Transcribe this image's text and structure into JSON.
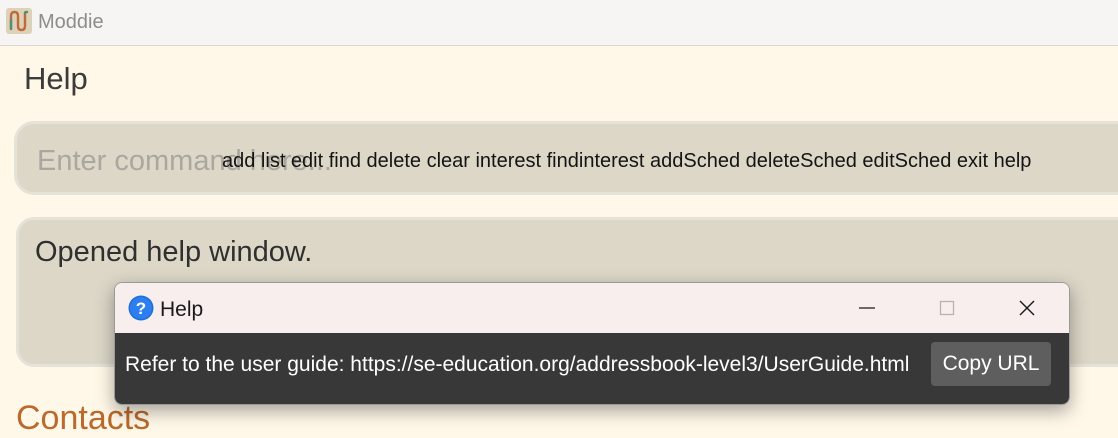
{
  "window": {
    "title": "Moddie",
    "icon": "moddie-logo-icon"
  },
  "menu": {
    "help_label": "Help"
  },
  "command_box": {
    "placeholder": "Enter command here...",
    "value": "",
    "suggestions": "add list edit find delete clear interest findinterest addSched deleteSched editSched exit help"
  },
  "result_display": {
    "text": "Opened help window."
  },
  "contacts_header": {
    "text": "Contacts"
  },
  "help_dialog": {
    "title": "Help",
    "icon": "help-question-icon",
    "message": "Refer to the user guide: https://se-education.org/addressbook-level3/UserGuide.html",
    "copy_button_label": "Copy URL",
    "controls": [
      "minimize-icon",
      "maximize-icon",
      "close-icon"
    ]
  },
  "colors": {
    "background": "#fff8e8",
    "box_fill": "#dcd7c7",
    "dialog_body": "#383838",
    "copy_button": "#5e5e5e",
    "contacts_accent": "#b96a2c",
    "help_icon_blue": "#1e6fd8"
  }
}
